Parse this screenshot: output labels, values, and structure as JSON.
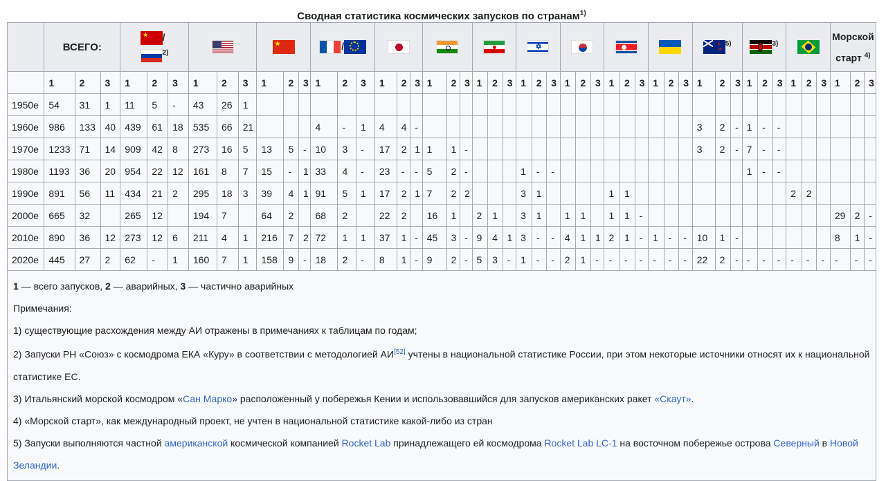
{
  "caption": {
    "title": "Сводная статистика космических запусков по странам",
    "sup": "1)"
  },
  "header": {
    "total": "ВСЕГО:",
    "ussr_russia_sup": "2)",
    "ussr_sep": "/",
    "fr_eu_sep": "/",
    "nz_sup": "5)",
    "ke_sup": "3)",
    "sea_launch": "Морской старт",
    "sea_launch_sup": "4)"
  },
  "column_numbers": [
    "1",
    "2",
    "3",
    "1",
    "2",
    "3",
    "1",
    "2",
    "3",
    "1",
    "2",
    "3",
    "1",
    "2",
    "3",
    "1",
    "2",
    "3",
    "1",
    "2",
    "3",
    "1",
    "2",
    "3",
    "1",
    "2",
    "3",
    "1",
    "2",
    "3",
    "1",
    "2",
    "3",
    "1",
    "2",
    "3",
    "1",
    "2",
    "3",
    "1",
    "2",
    "3",
    "1",
    "2",
    "3",
    "1",
    "2",
    "3"
  ],
  "rows": [
    {
      "decade": "1950е",
      "cells": [
        "54",
        "31",
        "1",
        "11",
        "5",
        "-",
        "43",
        "26",
        "1",
        "",
        "",
        "",
        "",
        "",
        "",
        "",
        "",
        "",
        "",
        "",
        "",
        "",
        "",
        "",
        "",
        "",
        "",
        "",
        "",
        "",
        "",
        "",
        "",
        "",
        "",
        "",
        "",
        "",
        "",
        "",
        "",
        "",
        "",
        "",
        "",
        "",
        "",
        ""
      ]
    },
    {
      "decade": "1960е",
      "cells": [
        "986",
        "133",
        "40",
        "439",
        "61",
        "18",
        "535",
        "66",
        "21",
        "",
        "",
        "",
        "4",
        "-",
        "1",
        "4",
        "4",
        "-",
        "",
        "",
        "",
        "",
        "",
        "",
        "",
        "",
        "",
        "",
        "",
        "",
        "",
        "",
        "",
        "",
        "",
        "",
        "3",
        "2",
        "-",
        "1",
        "-",
        "-",
        "",
        "",
        "",
        "",
        "",
        ""
      ]
    },
    {
      "decade": "1970е",
      "cells": [
        "1233",
        "71",
        "14",
        "909",
        "42",
        "8",
        "273",
        "16",
        "5",
        "13",
        "5",
        "-",
        "10",
        "3",
        "-",
        "17",
        "2",
        "1",
        "1",
        "1",
        "-",
        "",
        "",
        "",
        "",
        "",
        "",
        "",
        "",
        "",
        "",
        "",
        "",
        "",
        "",
        "",
        "3",
        "2",
        "-",
        "7",
        "-",
        "-",
        "",
        "",
        "",
        "",
        "",
        ""
      ]
    },
    {
      "decade": "1980е",
      "cells": [
        "1193",
        "36",
        "20",
        "954",
        "22",
        "12",
        "161",
        "8",
        "7",
        "15",
        "-",
        "1",
        "33",
        "4",
        "-",
        "23",
        "-",
        "-",
        "5",
        "2",
        "-",
        "",
        "",
        "",
        "1",
        "-",
        "-",
        "",
        "",
        "",
        "",
        "",
        "",
        "",
        "",
        "",
        "",
        "",
        "",
        "1",
        "-",
        "-",
        "",
        "",
        "",
        "",
        "",
        ""
      ]
    },
    {
      "decade": "1990е",
      "cells": [
        "891",
        "56",
        "11",
        "434",
        "21",
        "2",
        "295",
        "18",
        "3",
        "39",
        "4",
        "1",
        "91",
        "5",
        "1",
        "17",
        "2",
        "1",
        "7",
        "2",
        "2",
        "",
        "",
        "",
        "3",
        "1",
        "",
        "",
        "",
        "",
        "1",
        "1",
        "",
        "",
        "",
        "",
        "",
        "",
        "",
        "",
        "",
        "",
        "2",
        "2",
        "",
        "",
        "",
        ""
      ]
    },
    {
      "decade": "2000е",
      "cells": [
        "665",
        "32",
        "",
        "265",
        "12",
        "",
        "194",
        "7",
        "",
        "64",
        "2",
        "",
        "68",
        "2",
        "",
        "22",
        "2",
        "",
        "16",
        "1",
        "",
        "2",
        "1",
        "",
        "3",
        "1",
        "",
        "1",
        "1",
        "",
        "1",
        "1",
        "-",
        "",
        "",
        "",
        "",
        "",
        "",
        "",
        "",
        "",
        "",
        "",
        "",
        "29",
        "2",
        "-"
      ]
    },
    {
      "decade": "2010е",
      "cells": [
        "890",
        "36",
        "12",
        "273",
        "12",
        "6",
        "211",
        "4",
        "1",
        "216",
        "7",
        "2",
        "72",
        "1",
        "1",
        "37",
        "1",
        "-",
        "45",
        "3",
        "-",
        "9",
        "4",
        "1",
        "3",
        "-",
        "-",
        "4",
        "1",
        "1",
        "2",
        "1",
        "-",
        "1",
        "-",
        "-",
        "10",
        "1",
        "-",
        "",
        "",
        "",
        "",
        "",
        "",
        "8",
        "1",
        "-"
      ]
    },
    {
      "decade": "2020е",
      "cells": [
        "445",
        "27",
        "2",
        "62",
        "-",
        "1",
        "160",
        "7",
        "1",
        "158",
        "9",
        "-",
        "18",
        "2",
        "-",
        "8",
        "1",
        "-",
        "9",
        "2",
        "-",
        "5",
        "3",
        "-",
        "1",
        "-",
        "-",
        "2",
        "1",
        "-",
        "-",
        "-",
        "-",
        "-",
        "-",
        "-",
        "22",
        "2",
        "-",
        "-",
        "-",
        "-",
        "-",
        "-",
        "-",
        "-",
        "-",
        "-"
      ]
    }
  ],
  "notes": {
    "legend": {
      "b1": "1",
      "t1": " — всего запусков, ",
      "b2": "2",
      "t2": " — аварийных, ",
      "b3": "3",
      "t3": " — частично аварийных"
    },
    "heading": "Примечания:",
    "n1": "1) существующие расхождения между АИ отражены в примечаниях к таблицам по годам;",
    "n2a": "2) Запуски РН «Союз» с космодрома ЕКА «Куру» в соответствии с методологией АИ",
    "n2sup": "[52]",
    "n2b": " учтены в национальной статистике России, при этом некоторые источники относят их к национальной статистике ЕС.",
    "n3a": "3) Итальянский морской космодром «",
    "n3link1": "Сан Марко",
    "n3b": "» расположенный у побережья Кении и использовавшийся для запусков американских ракет ",
    "n3link2": "«Скаут»",
    "n3c": ".",
    "n4": "4) «Морской старт», как международный проект, не учтен в национальной статистике какой-либо из стран",
    "n5a": "5) Запуски выполняются частной ",
    "n5link1": "американской",
    "n5b": " космической компанией ",
    "n5link2": "Rocket Lab",
    "n5c": " принадлежащего ей космодрома ",
    "n5link3": "Rocket Lab LC-1",
    "n5d": " на восточном побережье острова ",
    "n5link4": "Северный",
    "n5e": " в ",
    "n5link5": "Новой Зеландии",
    "n5f": "."
  },
  "colors": {
    "link": "#3366cc",
    "border": "#a2a9b1",
    "header_bg": "#eaecf0",
    "cell_bg": "#f8f9fa"
  }
}
